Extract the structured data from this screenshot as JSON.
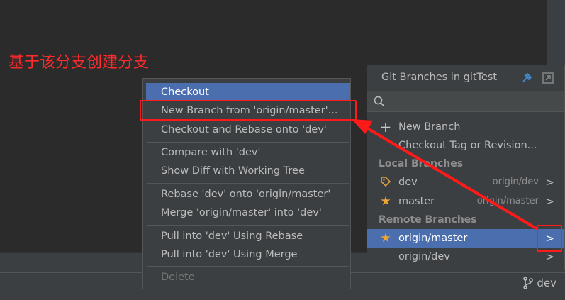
{
  "annotation": "基于该分支创建分支",
  "status_branch": "dev",
  "context_menu": {
    "items": [
      {
        "label": "Checkout"
      },
      {
        "label": "New Branch from 'origin/master'..."
      },
      {
        "label": "Checkout and Rebase onto 'dev'"
      },
      {
        "label": "Compare with 'dev'"
      },
      {
        "label": "Show Diff with Working Tree"
      },
      {
        "label": "Rebase 'dev' onto 'origin/master'"
      },
      {
        "label": "Merge 'origin/master' into 'dev'"
      },
      {
        "label": "Pull into 'dev' Using Rebase"
      },
      {
        "label": "Pull into 'dev' Using Merge"
      },
      {
        "label": "Delete"
      }
    ]
  },
  "popup": {
    "title": "Git Branches in gitTest",
    "search_placeholder": "",
    "actions": [
      {
        "label": "New Branch"
      },
      {
        "label": "Checkout Tag or Revision..."
      }
    ],
    "local_header": "Local Branches",
    "local": [
      {
        "name": "dev",
        "tracking": "origin/dev"
      },
      {
        "name": "master",
        "tracking": "origin/master"
      }
    ],
    "remote_header": "Remote Branches",
    "remote": [
      {
        "name": "origin/master"
      },
      {
        "name": "origin/dev"
      }
    ]
  },
  "colors": {
    "selection": "#4b6eaf",
    "annotation": "#ff2a2a",
    "star": "#f0a732"
  }
}
